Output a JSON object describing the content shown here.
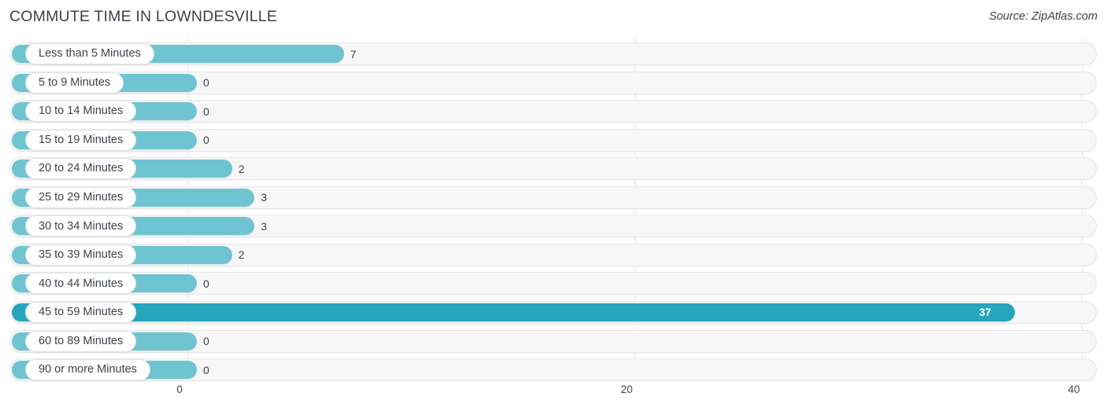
{
  "header": {
    "title": "COMMUTE TIME IN LOWNDESVILLE",
    "source": "Source: ZipAtlas.com"
  },
  "colors": {
    "bar_low": "#6fc4d1",
    "bar_high": "#26a5bd",
    "track": "#f7f7f8",
    "track_border": "#e6e7e8",
    "gridline": "#e3e4e6",
    "text": "#3c4249"
  },
  "chart_data": {
    "type": "bar",
    "orientation": "horizontal",
    "title": "COMMUTE TIME IN LOWNDESVILLE",
    "xlabel": "",
    "ylabel": "",
    "xlim": [
      0,
      40
    ],
    "xticks": [
      0,
      20,
      40
    ],
    "xtick_labels": [
      "0",
      "20",
      "40"
    ],
    "grid": true,
    "legend": false,
    "categories": [
      "Less than 5 Minutes",
      "5 to 9 Minutes",
      "10 to 14 Minutes",
      "15 to 19 Minutes",
      "20 to 24 Minutes",
      "25 to 29 Minutes",
      "30 to 34 Minutes",
      "35 to 39 Minutes",
      "40 to 44 Minutes",
      "45 to 59 Minutes",
      "60 to 89 Minutes",
      "90 or more Minutes"
    ],
    "values": [
      7,
      0,
      0,
      0,
      2,
      3,
      3,
      2,
      0,
      37,
      0,
      0
    ],
    "value_labels": [
      "7",
      "0",
      "0",
      "0",
      "2",
      "3",
      "3",
      "2",
      "0",
      "37",
      "0",
      "0"
    ]
  },
  "rows": [
    {
      "label": "Less than 5 Minutes",
      "value": 7,
      "value_label": "7",
      "highlight": false,
      "label_inside": false
    },
    {
      "label": "5 to 9 Minutes",
      "value": 0,
      "value_label": "0",
      "highlight": false,
      "label_inside": false
    },
    {
      "label": "10 to 14 Minutes",
      "value": 0,
      "value_label": "0",
      "highlight": false,
      "label_inside": false
    },
    {
      "label": "15 to 19 Minutes",
      "value": 0,
      "value_label": "0",
      "highlight": false,
      "label_inside": false
    },
    {
      "label": "20 to 24 Minutes",
      "value": 2,
      "value_label": "2",
      "highlight": false,
      "label_inside": false
    },
    {
      "label": "25 to 29 Minutes",
      "value": 3,
      "value_label": "3",
      "highlight": false,
      "label_inside": false
    },
    {
      "label": "30 to 34 Minutes",
      "value": 3,
      "value_label": "3",
      "highlight": false,
      "label_inside": false
    },
    {
      "label": "35 to 39 Minutes",
      "value": 2,
      "value_label": "2",
      "highlight": false,
      "label_inside": false
    },
    {
      "label": "40 to 44 Minutes",
      "value": 0,
      "value_label": "0",
      "highlight": false,
      "label_inside": false
    },
    {
      "label": "45 to 59 Minutes",
      "value": 37,
      "value_label": "37",
      "highlight": true,
      "label_inside": true
    },
    {
      "label": "60 to 89 Minutes",
      "value": 0,
      "value_label": "0",
      "highlight": false,
      "label_inside": false
    },
    {
      "label": "90 or more Minutes",
      "value": 0,
      "value_label": "0",
      "highlight": false,
      "label_inside": false
    }
  ],
  "axis": {
    "ticks": [
      {
        "label": "0",
        "value": 0
      },
      {
        "label": "20",
        "value": 20
      },
      {
        "label": "40",
        "value": 40
      }
    ]
  }
}
